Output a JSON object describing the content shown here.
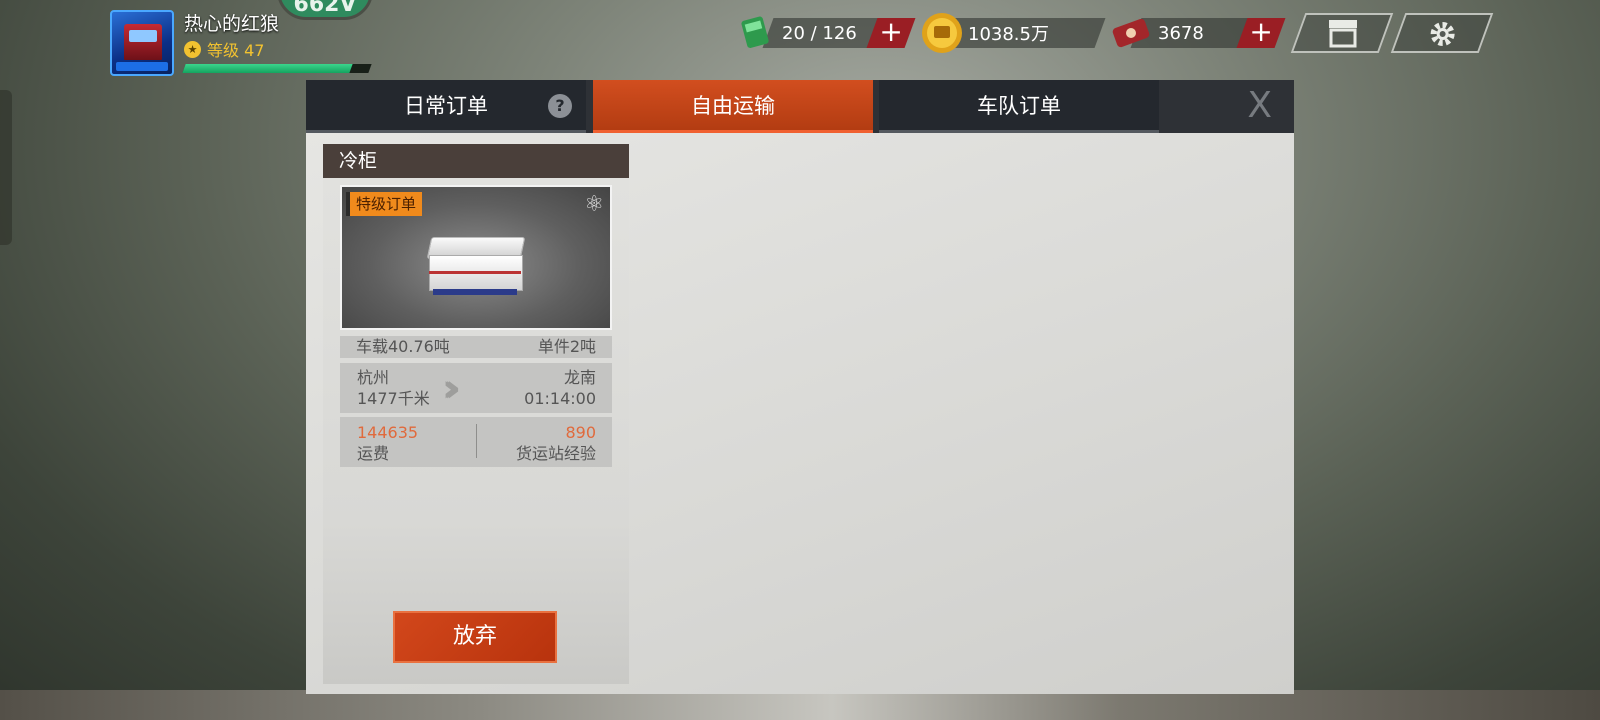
{
  "player": {
    "name": "热心的红狼",
    "level_text": "等级 47",
    "badge_text": "662V",
    "xp_progress": 0.9
  },
  "resources": {
    "energy": "20 / 126",
    "coins": "1038.5万",
    "tickets": "3678"
  },
  "icons": {
    "level_star": "★",
    "store": "store-icon",
    "settings": "gear-icon",
    "help": "?",
    "close": "X",
    "favorite": "⚛"
  },
  "tabs": [
    {
      "label": "日常订单"
    },
    {
      "label": "自由运输"
    },
    {
      "label": "车队订单"
    }
  ],
  "active_tab": "自由运输",
  "category": "冷柜",
  "order": {
    "badge": "特级订单",
    "load": "车载40.76吨",
    "unit": "单件2吨",
    "origin": "杭州",
    "distance": "1477千米",
    "destination": "龙南",
    "duration": "01:14:00",
    "freight_value": "144635",
    "freight_label": "运费",
    "exp_value": "890",
    "exp_label": "货运站经验"
  },
  "actions": {
    "abandon": "放弃"
  },
  "colors": {
    "accent": "#c9441a",
    "badge": "#f08a1c",
    "plus": "#9a1e24",
    "xp": "#1fbf70"
  }
}
